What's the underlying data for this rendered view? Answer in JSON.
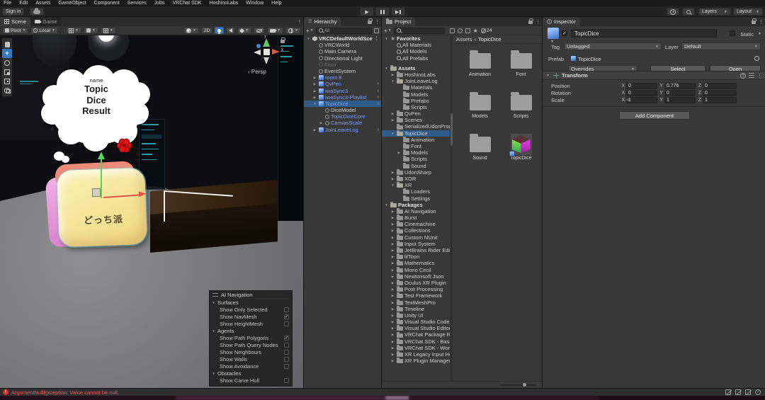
{
  "menu": {
    "items": [
      "File",
      "Edit",
      "Assets",
      "GameObject",
      "Component",
      "Services",
      "Jobs",
      "VRChat SDK",
      "HoshinoLabs",
      "Window",
      "Help"
    ]
  },
  "topbar": {
    "sign_in": "Sign in",
    "layers": "Layers",
    "layout": "Layout",
    "icons": [
      "cloud-icon",
      "play-icon",
      "pause-icon",
      "step-icon",
      "history-icon",
      "search-icon"
    ]
  },
  "scene": {
    "tabs": [
      {
        "label": "Scene",
        "icon": "grid-icon"
      },
      {
        "label": "Game",
        "icon": "gamepad-icon"
      }
    ],
    "toolbar": {
      "pivot": "Pivot",
      "local": "Local",
      "two_d": "2D",
      "icons": [
        "grid-visual-icon",
        "snap-icon",
        "increment-snap-icon",
        "render-mode-icon",
        "lighting-icon",
        "audio-icon",
        "effects-icon",
        "visibility-icon",
        "camera-icon",
        "gizmos-icon"
      ]
    },
    "gizmo": {
      "persp_label": "Persp",
      "axis_x": "x",
      "axis_y": "y"
    },
    "bubble": {
      "lines": [
        "name",
        "Topic",
        "Dice",
        "Result"
      ]
    },
    "dice_text": "どっち派",
    "tools": [
      "hand-tool",
      "move-tool",
      "rotate-tool",
      "scale-tool",
      "rect-tool",
      "transform-tool"
    ],
    "active_tool": "move-tool",
    "ai_navigation": {
      "title": "AI Navigation",
      "sections": [
        {
          "label": "Surfaces",
          "items": [
            {
              "label": "Show Only Selected",
              "checked": false
            },
            {
              "label": "Show NavMesh",
              "checked": true
            },
            {
              "label": "Show HeightMesh",
              "checked": false
            }
          ]
        },
        {
          "label": "Agents",
          "items": [
            {
              "label": "Show Path Polygons",
              "checked": true
            },
            {
              "label": "Show Path Query Nodes",
              "checked": false
            },
            {
              "label": "Show Neighbours",
              "checked": false
            },
            {
              "label": "Show Walls",
              "checked": false
            },
            {
              "label": "Show Avoidance",
              "checked": false
            }
          ]
        },
        {
          "label": "Obstacles",
          "items": [
            {
              "label": "Show Carve Hull",
              "checked": false
            }
          ]
        }
      ]
    }
  },
  "hierarchy": {
    "tab": "Hierarchy",
    "search_placeholder": "All",
    "items": [
      {
        "label": "VRCDefaultWorldScen",
        "depth": 0,
        "icon": "unity",
        "arrow": "down",
        "menu": true,
        "color": "bold"
      },
      {
        "label": "VRCWorld",
        "depth": 1,
        "icon": "circle"
      },
      {
        "label": "Main Camera",
        "depth": 1,
        "icon": "circle"
      },
      {
        "label": "Directional Light",
        "depth": 1,
        "icon": "circle"
      },
      {
        "label": "Floor",
        "depth": 1,
        "icon": "circle",
        "disabled": true
      },
      {
        "label": "EventSystem",
        "depth": 1,
        "icon": "circle"
      },
      {
        "label": "room 8",
        "depth": 1,
        "icon": "cube",
        "arrow": "right",
        "color": "prefab"
      },
      {
        "label": "QvPen",
        "depth": 1,
        "icon": "cube",
        "arrow": "right",
        "color": "prefab",
        "nav": true
      },
      {
        "label": "iwaSync3",
        "depth": 1,
        "icon": "cube",
        "arrow": "right",
        "color": "prefab",
        "nav": true
      },
      {
        "label": "iwaSync3-Playlist",
        "depth": 1,
        "icon": "cube",
        "arrow": "right",
        "color": "prefab",
        "nav": true
      },
      {
        "label": "TopicDice",
        "depth": 1,
        "icon": "cube",
        "arrow": "down",
        "color": "prefab",
        "selected": true,
        "nav": true
      },
      {
        "label": "DiceModel",
        "depth": 2,
        "icon": "circle"
      },
      {
        "label": "TopicDiceCore",
        "depth": 2,
        "icon": "circle",
        "color": "prefab"
      },
      {
        "label": "CanvasScale",
        "depth": 2,
        "icon": "circle",
        "arrow": "right",
        "color": "prefab"
      },
      {
        "label": "JoinLeaveLog",
        "depth": 1,
        "icon": "cube",
        "arrow": "right",
        "color": "prefab",
        "nav": true
      }
    ]
  },
  "project": {
    "tab": "Project",
    "hidden_count": "24",
    "breadcrumb": [
      "Assets",
      "TopicDice"
    ],
    "tree": [
      {
        "label": "Favorites",
        "depth": 0,
        "icon": "star",
        "arrow": "down",
        "bold": true
      },
      {
        "label": "All Materials",
        "depth": 1,
        "icon": "mag"
      },
      {
        "label": "All Models",
        "depth": 1,
        "icon": "mag"
      },
      {
        "label": "All Prefabs",
        "depth": 1,
        "icon": "mag"
      },
      {
        "label": "Assets",
        "depth": 0,
        "icon": "folder-open",
        "arrow": "down",
        "bold": true,
        "gap": true
      },
      {
        "label": "HoshinoLabs",
        "depth": 1,
        "icon": "folder",
        "arrow": "right"
      },
      {
        "label": "JoinLeaveLog",
        "depth": 1,
        "icon": "folder-open",
        "arrow": "down"
      },
      {
        "label": "Materials",
        "depth": 2,
        "icon": "folder"
      },
      {
        "label": "Models",
        "depth": 2,
        "icon": "folder"
      },
      {
        "label": "Prefabs",
        "depth": 2,
        "icon": "folder"
      },
      {
        "label": "Scripts",
        "depth": 2,
        "icon": "folder"
      },
      {
        "label": "QvPen",
        "depth": 1,
        "icon": "folder",
        "arrow": "right"
      },
      {
        "label": "Scenes",
        "depth": 1,
        "icon": "folder",
        "arrow": "right"
      },
      {
        "label": "SerializedUdonProgra",
        "depth": 1,
        "icon": "folder"
      },
      {
        "label": "TopicDice",
        "depth": 1,
        "icon": "folder-open",
        "arrow": "down",
        "selected": true
      },
      {
        "label": "Animation",
        "depth": 2,
        "icon": "folder"
      },
      {
        "label": "Font",
        "depth": 2,
        "icon": "folder"
      },
      {
        "label": "Models",
        "depth": 2,
        "icon": "folder",
        "arrow": "right"
      },
      {
        "label": "Scripts",
        "depth": 2,
        "icon": "folder"
      },
      {
        "label": "Sound",
        "depth": 2,
        "icon": "folder"
      },
      {
        "label": "UdonSharp",
        "depth": 1,
        "icon": "folder",
        "arrow": "right"
      },
      {
        "label": "XOR",
        "depth": 1,
        "icon": "folder",
        "arrow": "right"
      },
      {
        "label": "XR",
        "depth": 1,
        "icon": "folder-open",
        "arrow": "down"
      },
      {
        "label": "Loaders",
        "depth": 2,
        "icon": "folder"
      },
      {
        "label": "Settings",
        "depth": 2,
        "icon": "folder"
      },
      {
        "label": "Packages",
        "depth": 0,
        "icon": "folder-open",
        "arrow": "down",
        "bold": true
      },
      {
        "label": "AI Navigation",
        "depth": 1,
        "icon": "folder",
        "arrow": "right"
      },
      {
        "label": "Burst",
        "depth": 1,
        "icon": "folder",
        "arrow": "right"
      },
      {
        "label": "Cinemachine",
        "depth": 1,
        "icon": "folder",
        "arrow": "right"
      },
      {
        "label": "Collections",
        "depth": 1,
        "icon": "folder",
        "arrow": "right"
      },
      {
        "label": "Custom NUnit",
        "depth": 1,
        "icon": "folder",
        "arrow": "right"
      },
      {
        "label": "Input System",
        "depth": 1,
        "icon": "folder",
        "arrow": "right"
      },
      {
        "label": "JetBrains Rider Editor",
        "depth": 1,
        "icon": "folder",
        "arrow": "right"
      },
      {
        "label": "lilToon",
        "depth": 1,
        "icon": "folder",
        "arrow": "right"
      },
      {
        "label": "Mathematics",
        "depth": 1,
        "icon": "folder",
        "arrow": "right"
      },
      {
        "label": "Mono Cecil",
        "depth": 1,
        "icon": "folder",
        "arrow": "right"
      },
      {
        "label": "Newtonsoft Json",
        "depth": 1,
        "icon": "folder",
        "arrow": "right"
      },
      {
        "label": "Oculus XR Plugin",
        "depth": 1,
        "icon": "folder",
        "arrow": "right"
      },
      {
        "label": "Post Processing",
        "depth": 1,
        "icon": "folder",
        "arrow": "right"
      },
      {
        "label": "Test Framework",
        "depth": 1,
        "icon": "folder",
        "arrow": "right"
      },
      {
        "label": "TextMeshPro",
        "depth": 1,
        "icon": "folder",
        "arrow": "right"
      },
      {
        "label": "Timeline",
        "depth": 1,
        "icon": "folder",
        "arrow": "right"
      },
      {
        "label": "Unity UI",
        "depth": 1,
        "icon": "folder",
        "arrow": "right"
      },
      {
        "label": "Visual Studio Code Edi",
        "depth": 1,
        "icon": "folder",
        "arrow": "right"
      },
      {
        "label": "Visual Studio Editor",
        "depth": 1,
        "icon": "folder",
        "arrow": "right"
      },
      {
        "label": "VRChat Package Res",
        "depth": 1,
        "icon": "folder",
        "arrow": "right"
      },
      {
        "label": "VRChat SDK - Base",
        "depth": 1,
        "icon": "folder",
        "arrow": "right"
      },
      {
        "label": "VRChat SDK - Worlds",
        "depth": 1,
        "icon": "folder",
        "arrow": "right"
      },
      {
        "label": "XR Legacy Input Help",
        "depth": 1,
        "icon": "folder",
        "arrow": "right"
      },
      {
        "label": "XR Plugin Manageme",
        "depth": 1,
        "icon": "folder",
        "arrow": "right"
      }
    ],
    "grid": [
      {
        "label": "Animation",
        "type": "folder"
      },
      {
        "label": "Font",
        "type": "folder"
      },
      {
        "label": "Models",
        "type": "folder"
      },
      {
        "label": "Scripts",
        "type": "folder"
      },
      {
        "label": "Sound",
        "type": "folder"
      },
      {
        "label": "TopicDice",
        "type": "prefab"
      }
    ]
  },
  "inspector": {
    "tab": "Inspector",
    "name": "TopicDice",
    "static_label": "Static",
    "tag_label": "Tag",
    "tag_value": "Untagged",
    "layer_label": "Layer",
    "layer_value": "Default",
    "prefab_label": "Prefab",
    "prefab_name": "TopicDice",
    "overrides_label": "Overrides",
    "select_label": "Select",
    "open_label": "Open",
    "transform": {
      "title": "Transform",
      "axis_labels": {
        "x": "X",
        "y": "Y",
        "z": "Z"
      },
      "position": {
        "label": "Position",
        "x": "0",
        "y": "0.776",
        "z": "0"
      },
      "rotation": {
        "label": "Rotation",
        "x": "0",
        "y": "0",
        "z": "0"
      },
      "scale": {
        "label": "Scale",
        "x": "1",
        "y": "1",
        "z": "1"
      }
    },
    "add_component": "Add Component"
  },
  "status_bar": {
    "error": "ArgumentNullException: Value cannot be null.",
    "icons": [
      "mute-messages-icon",
      "mute-warnings-icon",
      "mute-errors-icon",
      "status-ok-icon"
    ]
  },
  "colors": {
    "selection": "#2e5b87",
    "prefab_text": "#7c9eff",
    "error_text": "#f25555",
    "accent_blue": "#3a79bb"
  }
}
